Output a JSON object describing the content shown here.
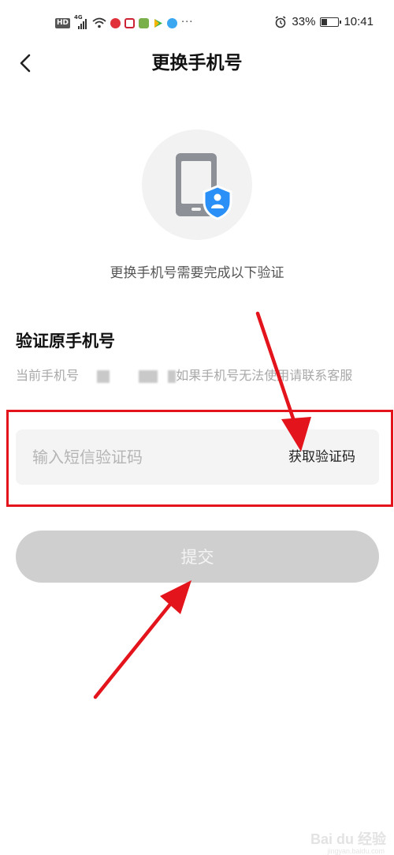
{
  "status_bar": {
    "network_badge": "HD",
    "network_type": "4G",
    "battery_percent": "33%",
    "battery_level": 0.33,
    "time": "10:41",
    "more_indicator": "···"
  },
  "header": {
    "back_icon": "chevron-left-icon",
    "title": "更换手机号"
  },
  "hero": {
    "icon": "phone-with-user-shield-icon",
    "shield_color": "#2a8ff7",
    "subtitle": "更换手机号需要完成以下验证"
  },
  "verify": {
    "section_title": "验证原手机号",
    "note_prefix": "当前手机号",
    "note_suffix": "如果手机号无法使用请联系客服"
  },
  "code_field": {
    "placeholder": "输入短信验证码",
    "value": "",
    "get_code_label": "获取验证码"
  },
  "submit": {
    "label": "提交"
  },
  "annotation": {
    "color": "#e4141c"
  },
  "watermark": {
    "text": "Bai du 经验",
    "sub": "jingyan.baidu.com"
  }
}
